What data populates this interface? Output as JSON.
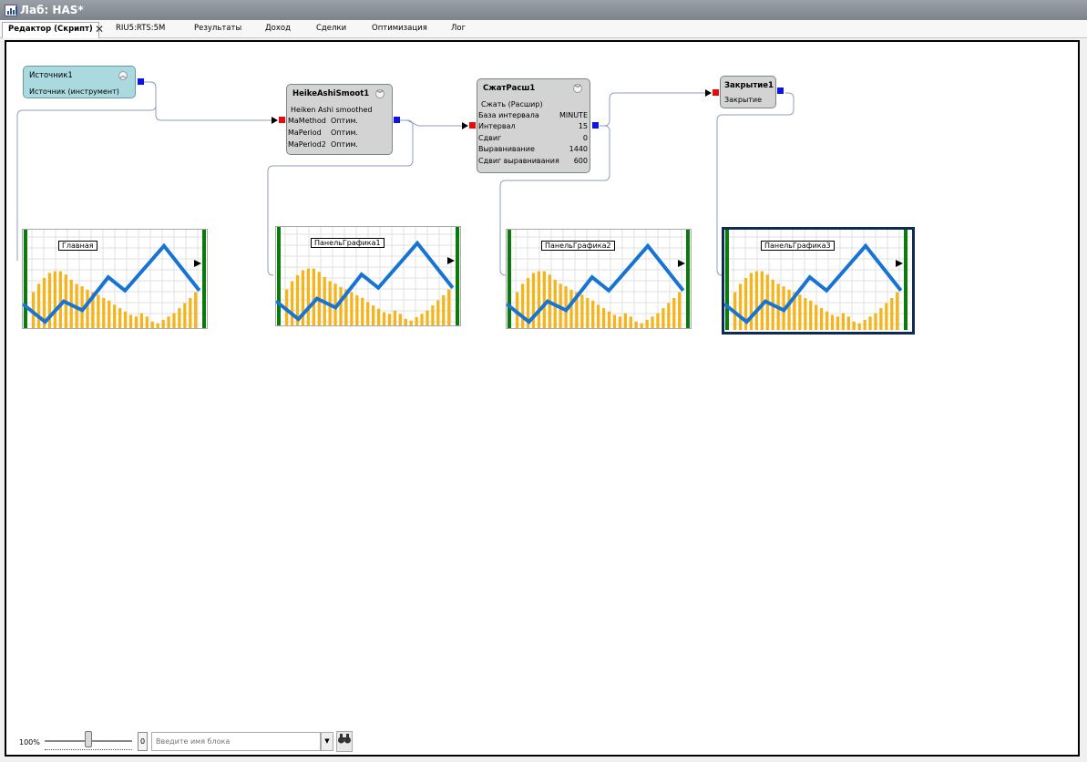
{
  "window": {
    "title": "Лаб: HAS*"
  },
  "tabs": [
    {
      "label": "Редактор (Скрипт)"
    },
    {
      "label": "RIU5:RTS:5M"
    },
    {
      "label": "Результаты"
    },
    {
      "label": "Доход"
    },
    {
      "label": "Сделки"
    },
    {
      "label": "Оптимизация"
    },
    {
      "label": "Лог"
    }
  ],
  "icons": {
    "collapse": "chevron-up-icon",
    "expand": "chevron-down-icon",
    "find": "binoculars-icon",
    "close": "close-icon"
  },
  "colors": {
    "input_port": "#e60a0a",
    "output_port": "#0a14e6",
    "bars": "#f4b41a",
    "line": "#1874d2",
    "source_block": "#aad9e0",
    "block": "#d3d3d3"
  },
  "blocks": {
    "source": {
      "title": "Источник1",
      "subtitle": "Источник (инструмент)"
    },
    "heikin": {
      "title": "HeikeAshiSmoot1",
      "subtitle": "Heiken Ashi smoothed",
      "params": [
        {
          "name": "MaMethod",
          "value": "Оптим."
        },
        {
          "name": "MaPeriod",
          "value": "Оптим."
        },
        {
          "name": "MaPeriod2",
          "value": "Оптим."
        }
      ]
    },
    "compress": {
      "title": "СжатРасш1",
      "subtitle": "Сжать (Расшир)",
      "params": [
        {
          "name": "База интервала",
          "value": "MINUTE"
        },
        {
          "name": "Интервал",
          "value": "15"
        },
        {
          "name": "Сдвиг",
          "value": "0"
        },
        {
          "name": "Выравнивание",
          "value": "1440"
        },
        {
          "name": "Сдвиг выравнивания",
          "value": "600"
        }
      ]
    },
    "close": {
      "title": "Закрытие1",
      "subtitle": "Закрытие"
    }
  },
  "panels": [
    {
      "label": "Главная"
    },
    {
      "label": "ПанельГрафика1"
    },
    {
      "label": "ПанельГрафика2"
    },
    {
      "label": "ПанельГрафика3"
    }
  ],
  "bottom": {
    "zoom": "100%",
    "zoom_box": "0",
    "search_placeholder": "Введите имя блока"
  }
}
